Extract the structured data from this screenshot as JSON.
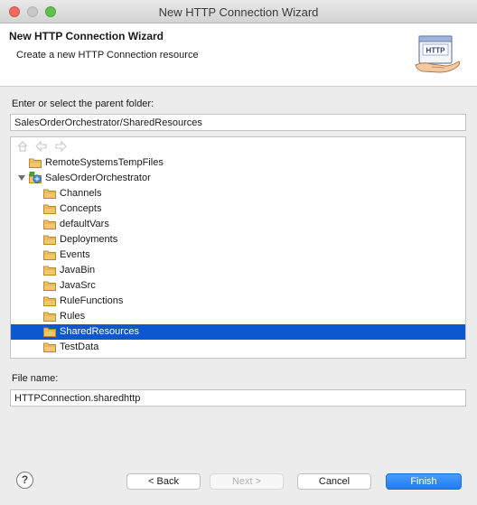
{
  "window": {
    "title": "New HTTP Connection Wizard"
  },
  "header": {
    "title": "New HTTP Connection Wizard",
    "description": "Create a new HTTP Connection resource",
    "image_text": "HTTP"
  },
  "parent_folder": {
    "label": "Enter or select the parent folder:",
    "value": "SalesOrderOrchestrator/SharedResources"
  },
  "tree": {
    "items": [
      {
        "label": "RemoteSystemsTempFiles"
      },
      {
        "label": "SalesOrderOrchestrator"
      },
      {
        "label": "Channels"
      },
      {
        "label": "Concepts"
      },
      {
        "label": "defaultVars"
      },
      {
        "label": "Deployments"
      },
      {
        "label": "Events"
      },
      {
        "label": "JavaBin"
      },
      {
        "label": "JavaSrc"
      },
      {
        "label": "RuleFunctions"
      },
      {
        "label": "Rules"
      },
      {
        "label": "SharedResources",
        "selected": true
      },
      {
        "label": "TestData"
      }
    ]
  },
  "file_name": {
    "label": "File name:",
    "value": "HTTPConnection.sharedhttp"
  },
  "buttons": {
    "help": "?",
    "back": "< Back",
    "next": "Next >",
    "cancel": "Cancel",
    "finish": "Finish"
  },
  "colors": {
    "selection": "#0a57d0",
    "folder": "#f2c76a",
    "primary": "#1c7ef5"
  }
}
